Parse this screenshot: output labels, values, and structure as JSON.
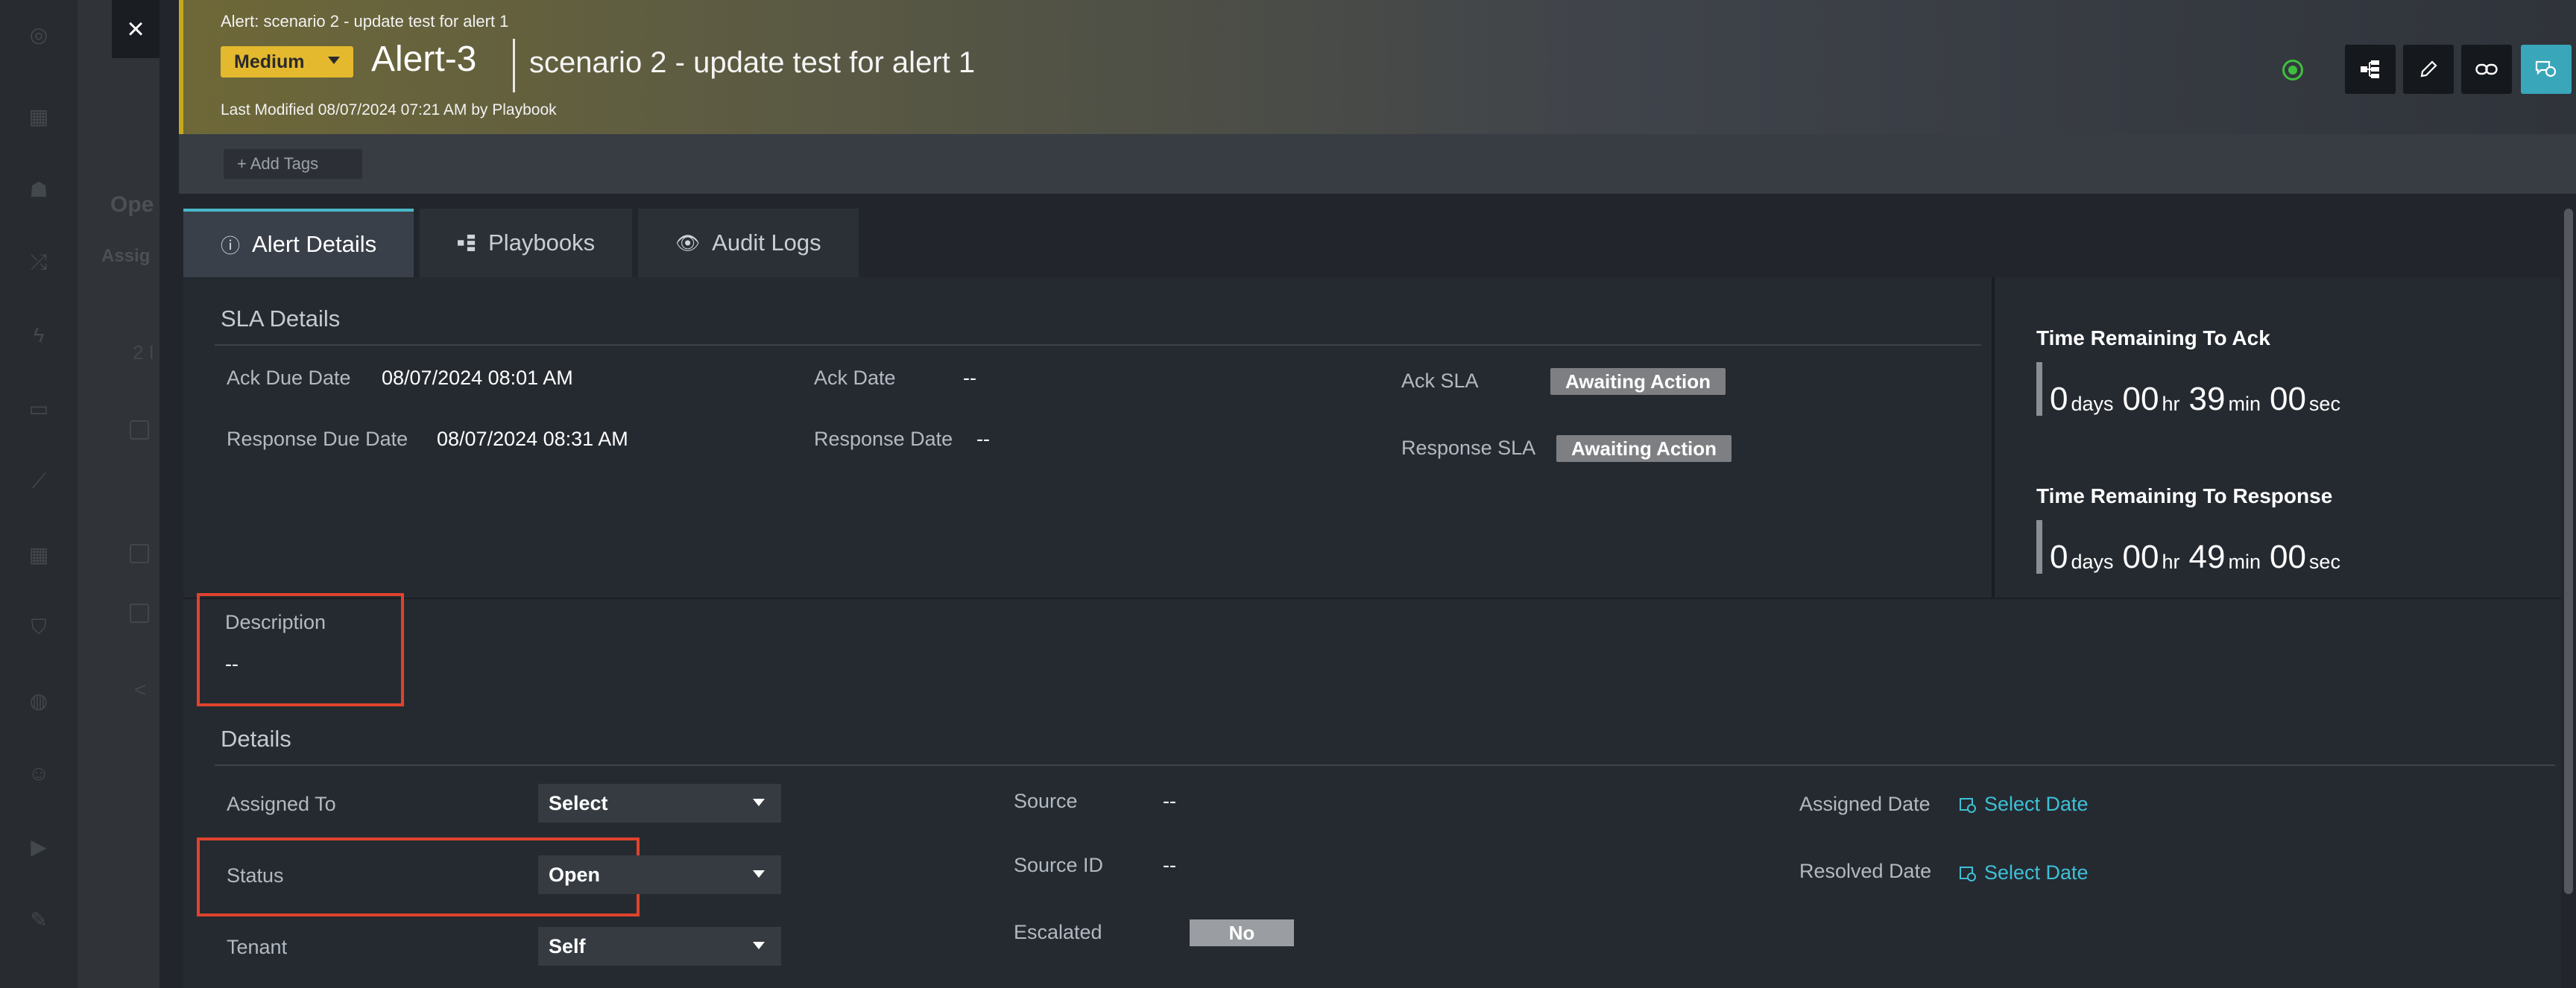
{
  "background": {
    "heading": "Ope",
    "subheading": "Assig",
    "count_text": "2 I",
    "pager_arrow": "<"
  },
  "header": {
    "subtitle": "Alert: scenario 2 - update test for alert 1",
    "severity": "Medium",
    "alert_id": "Alert-3",
    "alert_name": "scenario 2 - update test for alert 1",
    "last_modified": "Last Modified 08/07/2024 07:21 AM by Playbook",
    "accent_color": "#e4b92e",
    "status_color": "#3fbf3f",
    "chat_button_color": "#3aa6b9"
  },
  "tags": {
    "add_label": "+ Add Tags"
  },
  "tabs": [
    {
      "label": "Alert Details",
      "icon": "alert-circle-icon",
      "active": true
    },
    {
      "label": "Playbooks",
      "icon": "playbook-icon",
      "active": false
    },
    {
      "label": "Audit Logs",
      "icon": "eye-icon",
      "active": false
    }
  ],
  "sla": {
    "title": "SLA Details",
    "ack_due_label": "Ack Due Date",
    "ack_due_value": "08/07/2024 08:01 AM",
    "response_due_label": "Response Due Date",
    "response_due_value": "08/07/2024 08:31 AM",
    "ack_date_label": "Ack Date",
    "ack_date_value": "--",
    "response_date_label": "Response Date",
    "response_date_value": "--",
    "ack_sla_label": "Ack SLA",
    "ack_sla_value": "Awaiting Action",
    "response_sla_label": "Response SLA",
    "response_sla_value": "Awaiting Action"
  },
  "timers": {
    "ack": {
      "title": "Time Remaining To Ack",
      "days": "0",
      "days_unit": "days",
      "hours": "00",
      "hours_unit": "hr",
      "minutes": "39",
      "minutes_unit": "min",
      "seconds": "00",
      "seconds_unit": "sec"
    },
    "response": {
      "title": "Time Remaining To Response",
      "days": "0",
      "days_unit": "days",
      "hours": "00",
      "hours_unit": "hr",
      "minutes": "49",
      "minutes_unit": "min",
      "seconds": "00",
      "seconds_unit": "sec"
    }
  },
  "description": {
    "label": "Description",
    "value": "--"
  },
  "details": {
    "title": "Details",
    "assigned_to_label": "Assigned To",
    "assigned_to_value": "Select",
    "status_label": "Status",
    "status_value": "Open",
    "tenant_label": "Tenant",
    "tenant_value": "Self",
    "source_label": "Source",
    "source_value": "--",
    "source_id_label": "Source ID",
    "source_id_value": "--",
    "escalated_label": "Escalated",
    "escalated_value": "No",
    "assigned_date_label": "Assigned Date",
    "assigned_date_value": "Select Date",
    "resolved_date_label": "Resolved Date",
    "resolved_date_value": "Select Date"
  }
}
